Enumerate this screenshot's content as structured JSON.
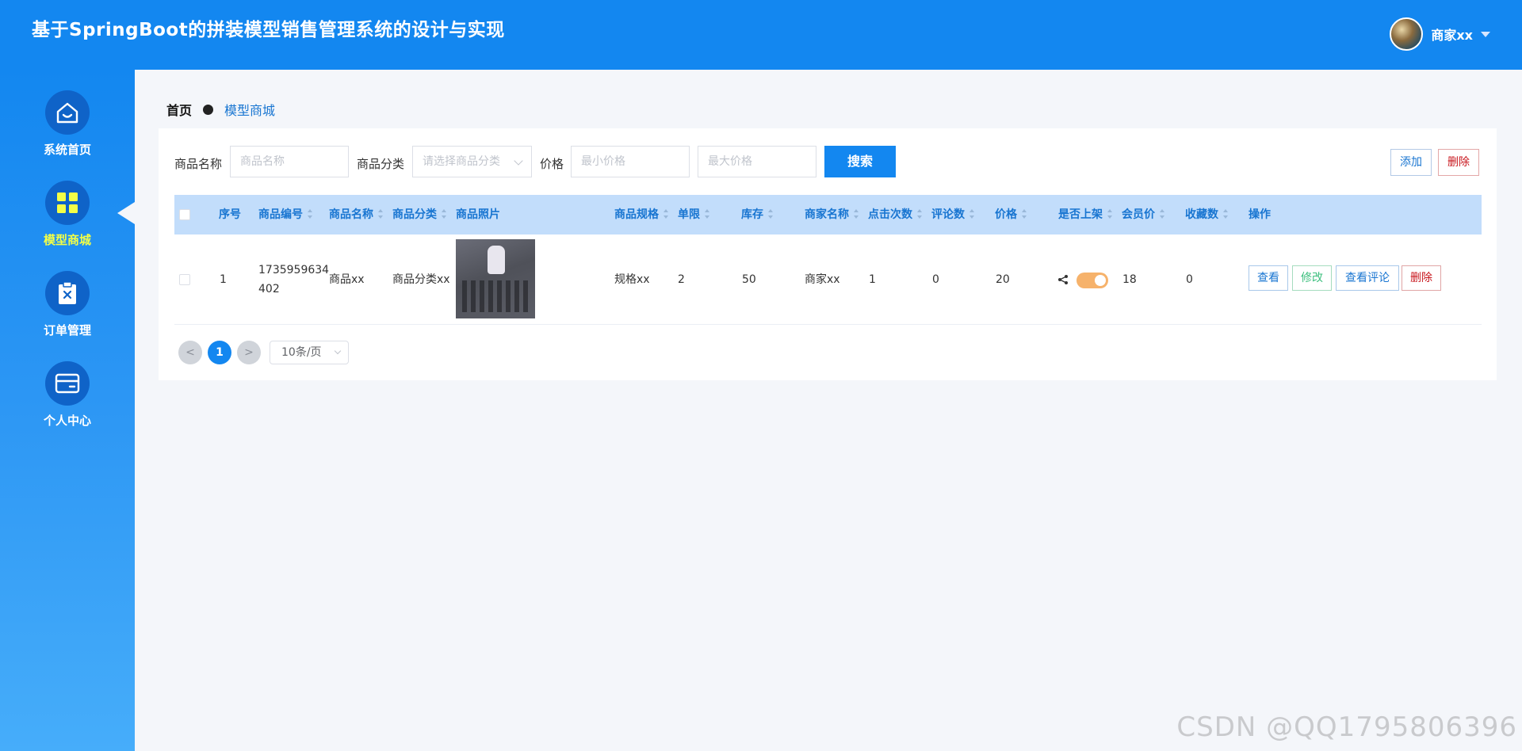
{
  "header": {
    "title": "基于SpringBoot的拼装模型销售管理系统的设计与实现",
    "user_name": "商家xx"
  },
  "sidebar": {
    "items": [
      {
        "label": "系统首页",
        "icon": "home-icon",
        "active": false
      },
      {
        "label": "模型商城",
        "icon": "grid-icon",
        "active": true
      },
      {
        "label": "订单管理",
        "icon": "clipboard-icon",
        "active": false
      },
      {
        "label": "个人中心",
        "icon": "wallet-icon",
        "active": false
      }
    ]
  },
  "breadcrumb": {
    "home": "首页",
    "current": "模型商城"
  },
  "filters": {
    "name_label": "商品名称",
    "name_placeholder": "商品名称",
    "category_label": "商品分类",
    "category_placeholder": "请选择商品分类",
    "price_label": "价格",
    "min_price_placeholder": "最小价格",
    "max_price_placeholder": "最大价格",
    "search_button": "搜索"
  },
  "toolbar": {
    "add_label": "添加",
    "delete_label": "删除"
  },
  "table": {
    "columns": [
      "序号",
      "商品编号",
      "商品名称",
      "商品分类",
      "商品照片",
      "商品规格",
      "单限",
      "库存",
      "商家名称",
      "点击次数",
      "评论数",
      "价格",
      "是否上架",
      "会员价",
      "收藏数",
      "操作"
    ],
    "rows": [
      {
        "index": "1",
        "code_line1": "1735959634",
        "code_line2": "402",
        "name": "商品xx",
        "category": "商品分类xx",
        "photo_icon": "model-kit-photo",
        "spec": "规格xx",
        "limit": "2",
        "stock": "50",
        "merchant": "商家xx",
        "clicks": "1",
        "comments": "0",
        "price": "20",
        "on_sale": true,
        "member_price": "18",
        "favorites": "0",
        "actions": {
          "view": "查看",
          "edit": "修改",
          "view_comments": "查看评论",
          "delete": "删除"
        }
      }
    ]
  },
  "pagination": {
    "prev": "<",
    "current": "1",
    "next": ">",
    "page_size": "10条/页"
  },
  "watermark": "CSDN @QQ1795806396",
  "colors": {
    "primary": "#1387f0",
    "active_nav_text": "#f3ff47",
    "toggle_on": "#f6b26b",
    "danger": "#c8161d",
    "success": "#3cbf7e"
  }
}
